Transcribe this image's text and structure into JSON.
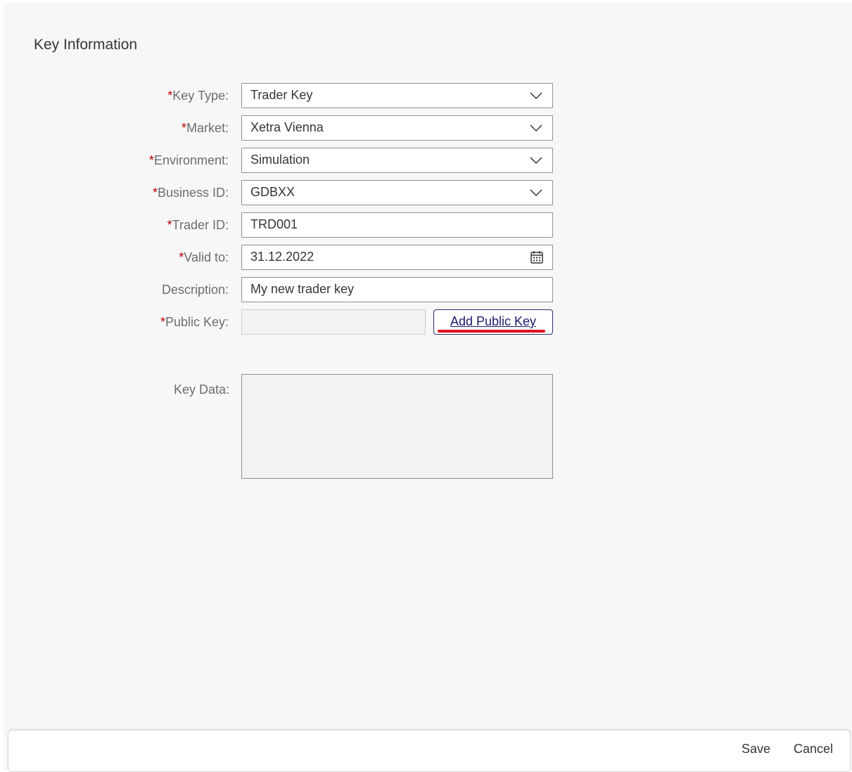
{
  "section_title": "Key Information",
  "fields": {
    "key_type": {
      "label": "Key Type:",
      "value": "Trader Key"
    },
    "market": {
      "label": "Market:",
      "value": "Xetra Vienna"
    },
    "environment": {
      "label": "Environment:",
      "value": "Simulation"
    },
    "business_id": {
      "label": "Business ID:",
      "value": "GDBXX"
    },
    "trader_id": {
      "label": "Trader ID:",
      "value": "TRD001"
    },
    "valid_to": {
      "label": "Valid to:",
      "value": "31.12.2022"
    },
    "description": {
      "label": "Description:",
      "value": "My new trader key"
    },
    "public_key": {
      "label": "Public Key:",
      "value": "",
      "button_label": "Add Public Key"
    },
    "key_data": {
      "label": "Key Data:",
      "value": ""
    }
  },
  "required_marker": "*",
  "footer": {
    "save_label": "Save",
    "cancel_label": "Cancel"
  },
  "icons": {
    "dropdown": "chevron-down-icon",
    "calendar": "calendar-icon"
  },
  "colors": {
    "required": "#bb0000",
    "button_border": "#2c2c6e",
    "highlight": "#e0141c"
  }
}
